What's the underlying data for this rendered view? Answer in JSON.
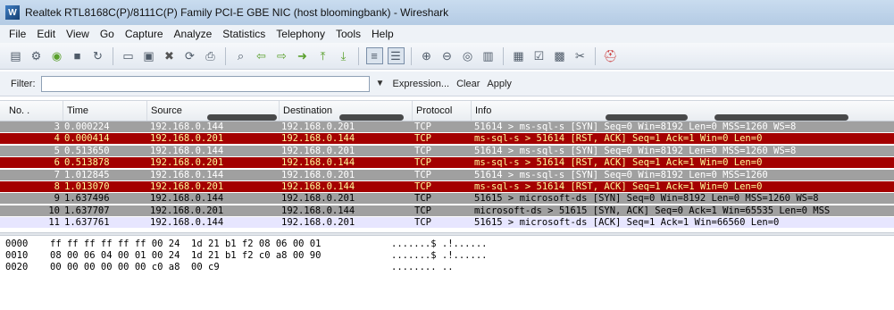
{
  "window": {
    "title": "Realtek RTL8168C(P)/8111C(P) Family PCI-E GBE NIC (host bloomingbank) - Wireshark"
  },
  "menu": [
    "File",
    "Edit",
    "View",
    "Go",
    "Capture",
    "Analyze",
    "Statistics",
    "Telephony",
    "Tools",
    "Help"
  ],
  "toolbar_icons": [
    "interface-list-icon",
    "capture-options-icon",
    "start-capture-icon",
    "stop-capture-icon",
    "restart-capture-icon",
    "open-file-icon",
    "save-file-icon",
    "close-file-icon",
    "reload-icon",
    "print-icon",
    "find-packet-icon",
    "go-back-icon",
    "go-forward-icon",
    "go-to-packet-icon",
    "go-first-icon",
    "go-last-icon",
    "colorize-icon",
    "auto-scroll-icon",
    "zoom-in-icon",
    "zoom-out-icon",
    "normal-size-icon",
    "resize-columns-icon",
    "capture-filters-icon",
    "display-filters-icon",
    "coloring-rules-icon",
    "preferences-icon",
    "help-icon"
  ],
  "filter": {
    "label": "Filter:",
    "value": "",
    "expression": "Expression...",
    "clear": "Clear",
    "apply": "Apply"
  },
  "columns": [
    "No. .",
    "Time",
    "Source",
    "Destination",
    "Protocol",
    "Info"
  ],
  "packets": [
    {
      "no": "3",
      "time": "0.000224",
      "src": "192.168.0.144",
      "dst": "192.168.0.201",
      "proto": "TCP",
      "info": "51614 > ms-sql-s [SYN] Seq=0 Win=8192 Len=0 MSS=1260 WS=8",
      "style": "normal"
    },
    {
      "no": "4",
      "time": "0.000414",
      "src": "192.168.0.201",
      "dst": "192.168.0.144",
      "proto": "TCP",
      "info": "ms-sql-s > 51614 [RST, ACK] Seq=1 Ack=1 Win=0 Len=0",
      "style": "rst"
    },
    {
      "no": "5",
      "time": "0.513650",
      "src": "192.168.0.144",
      "dst": "192.168.0.201",
      "proto": "TCP",
      "info": "51614 > ms-sql-s [SYN] Seq=0 Win=8192 Len=0 MSS=1260 WS=8",
      "style": "normal"
    },
    {
      "no": "6",
      "time": "0.513878",
      "src": "192.168.0.201",
      "dst": "192.168.0.144",
      "proto": "TCP",
      "info": "ms-sql-s > 51614 [RST, ACK] Seq=1 Ack=1 Win=0 Len=0",
      "style": "rst"
    },
    {
      "no": "7",
      "time": "1.012845",
      "src": "192.168.0.144",
      "dst": "192.168.0.201",
      "proto": "TCP",
      "info": "51614 > ms-sql-s [SYN] Seq=0 Win=8192 Len=0 MSS=1260",
      "style": "normal"
    },
    {
      "no": "8",
      "time": "1.013070",
      "src": "192.168.0.201",
      "dst": "192.168.0.144",
      "proto": "TCP",
      "info": "ms-sql-s > 51614 [RST, ACK] Seq=1 Ack=1 Win=0 Len=0",
      "style": "rst"
    },
    {
      "no": "9",
      "time": "1.637496",
      "src": "192.168.0.144",
      "dst": "192.168.0.201",
      "proto": "TCP",
      "info": "51615 > microsoft-ds [SYN] Seq=0 Win=8192 Len=0 MSS=1260 WS=8",
      "style": "syn2"
    },
    {
      "no": "10",
      "time": "1.637707",
      "src": "192.168.0.201",
      "dst": "192.168.0.144",
      "proto": "TCP",
      "info": "microsoft-ds > 51615 [SYN, ACK] Seq=0 Ack=1 Win=65535 Len=0 MSS",
      "style": "synack"
    },
    {
      "no": "11",
      "time": "1.637761",
      "src": "192.168.0.144",
      "dst": "192.168.0.201",
      "proto": "TCP",
      "info": "51615 > microsoft-ds [ACK] Seq=1 Ack=1 Win=66560 Len=0",
      "style": "ack"
    }
  ],
  "row_colors": {
    "normal": {
      "bg": "#a0a0a0",
      "fg": "#ffffff"
    },
    "rst": {
      "bg": "#a40000",
      "fg": "#fffc9c"
    },
    "syn2": {
      "bg": "#a0a0a0",
      "fg": "#000000"
    },
    "synack": {
      "bg": "#a0a0a0",
      "fg": "#000000"
    },
    "ack": {
      "bg": "#e7e6ff",
      "fg": "#000000"
    }
  },
  "hex_dump": [
    {
      "offset": "0000",
      "bytes": "ff ff ff ff ff ff 00 24  1d 21 b1 f2 08 06 00 01",
      "ascii": ".......$ .!......"
    },
    {
      "offset": "0010",
      "bytes": "08 00 06 04 00 01 00 24  1d 21 b1 f2 c0 a8 00 90",
      "ascii": ".......$ .!......"
    },
    {
      "offset": "0020",
      "bytes": "00 00 00 00 00 00 c0 a8  00 c9",
      "ascii": "........ .."
    }
  ]
}
